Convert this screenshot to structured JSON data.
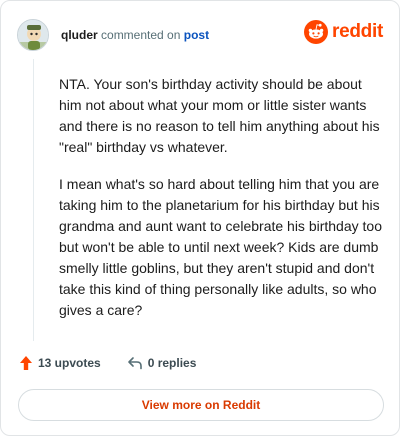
{
  "header": {
    "username": "qluder",
    "action_text": "commented on",
    "post_link": "post",
    "brand_word": "reddit"
  },
  "comment": {
    "paragraphs": [
      "NTA. Your son's birthday activity should be about him not about what your mom or little sister wants and there is no reason to tell him anything about his \"real\" birthday vs whatever.",
      "I mean what's so hard about telling him that you are taking him to the planetarium for his birthday but his grandma and aunt want to celebrate his birthday too but won't be able to until next week? Kids are dumb smelly little goblins, but they aren't stupid and don't take this kind of thing personally like adults, so who gives a care?"
    ]
  },
  "footer": {
    "upvotes": "13 upvotes",
    "replies": "0 replies"
  },
  "view_more_label": "View more on Reddit",
  "icons": {
    "avatar": "avatar-icon",
    "brand": "reddit-logo-icon",
    "upvote": "upvote-arrow-icon",
    "reply": "reply-arrow-icon"
  },
  "colors": {
    "brand": "#ff4500",
    "upvote": "#ff4500",
    "link": "#0a53be",
    "view_more": "#d93a00"
  }
}
